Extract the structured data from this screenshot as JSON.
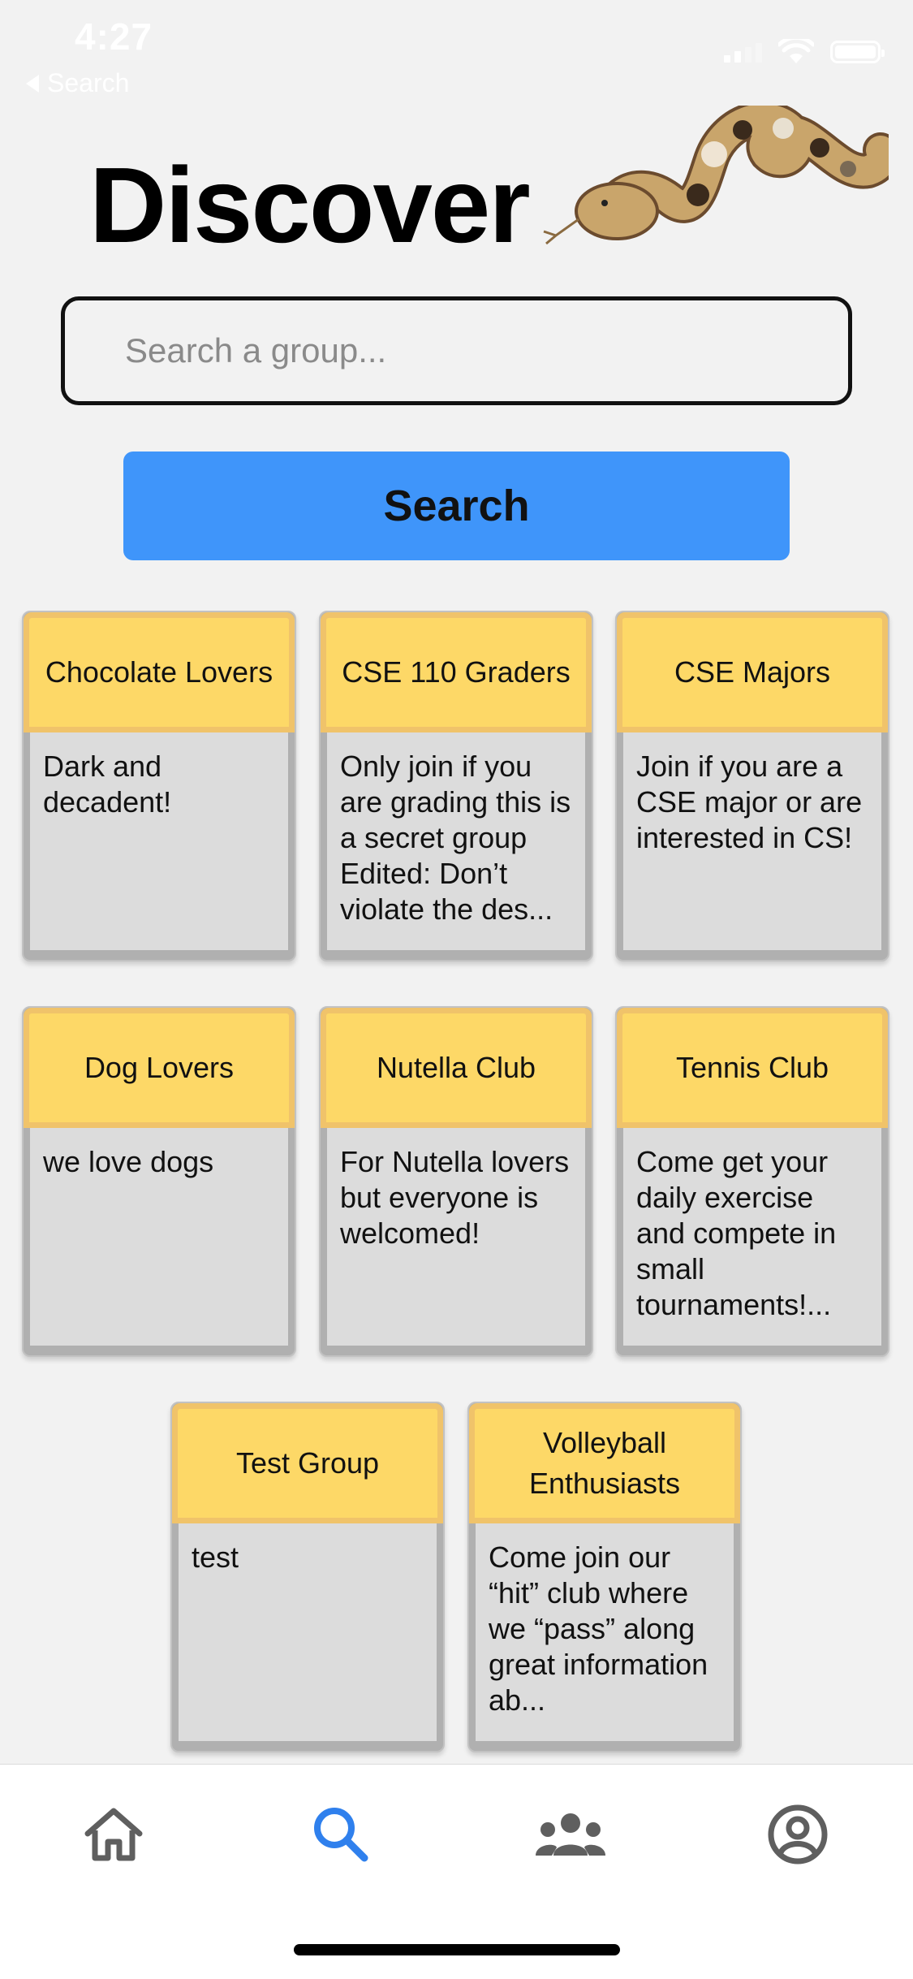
{
  "status_bar": {
    "time": "4:27",
    "back_label": "Search"
  },
  "header": {
    "title": "Discover",
    "mascot": "snake-illustration"
  },
  "search": {
    "placeholder": "Search a group...",
    "value": "",
    "button_label": "Search",
    "button_color": "#3f95fa"
  },
  "groups": [
    {
      "name": "Chocolate Lovers",
      "description": "Dark and decadent!"
    },
    {
      "name": "CSE 110 Graders",
      "description": "Only join if you are grading this is a secret group Edited: Don’t violate the des..."
    },
    {
      "name": "CSE Majors",
      "description": "Join if you are a CSE major or are interested in CS!"
    },
    {
      "name": "Dog Lovers",
      "description": "we love dogs"
    },
    {
      "name": "Nutella Club",
      "description": "For Nutella lovers but everyone is welcomed!"
    },
    {
      "name": "Tennis Club",
      "description": "Come get your daily exercise and compete in small tournaments!..."
    },
    {
      "name": "Test Group",
      "description": "test"
    },
    {
      "name": "Volleyball Enthusiasts",
      "description": "Come join our “hit” club where we “pass” along great information ab..."
    }
  ],
  "card_colors": {
    "header": "#fdd867",
    "header_border": "#f0c36a",
    "body": "#dcdcdc"
  },
  "tab_bar": {
    "tabs": [
      {
        "icon": "home-icon",
        "active": false
      },
      {
        "icon": "search-icon",
        "active": true
      },
      {
        "icon": "groups-icon",
        "active": false
      },
      {
        "icon": "profile-icon",
        "active": false
      }
    ],
    "active_color": "#2f80ed",
    "inactive_color": "#5f5f5f"
  }
}
